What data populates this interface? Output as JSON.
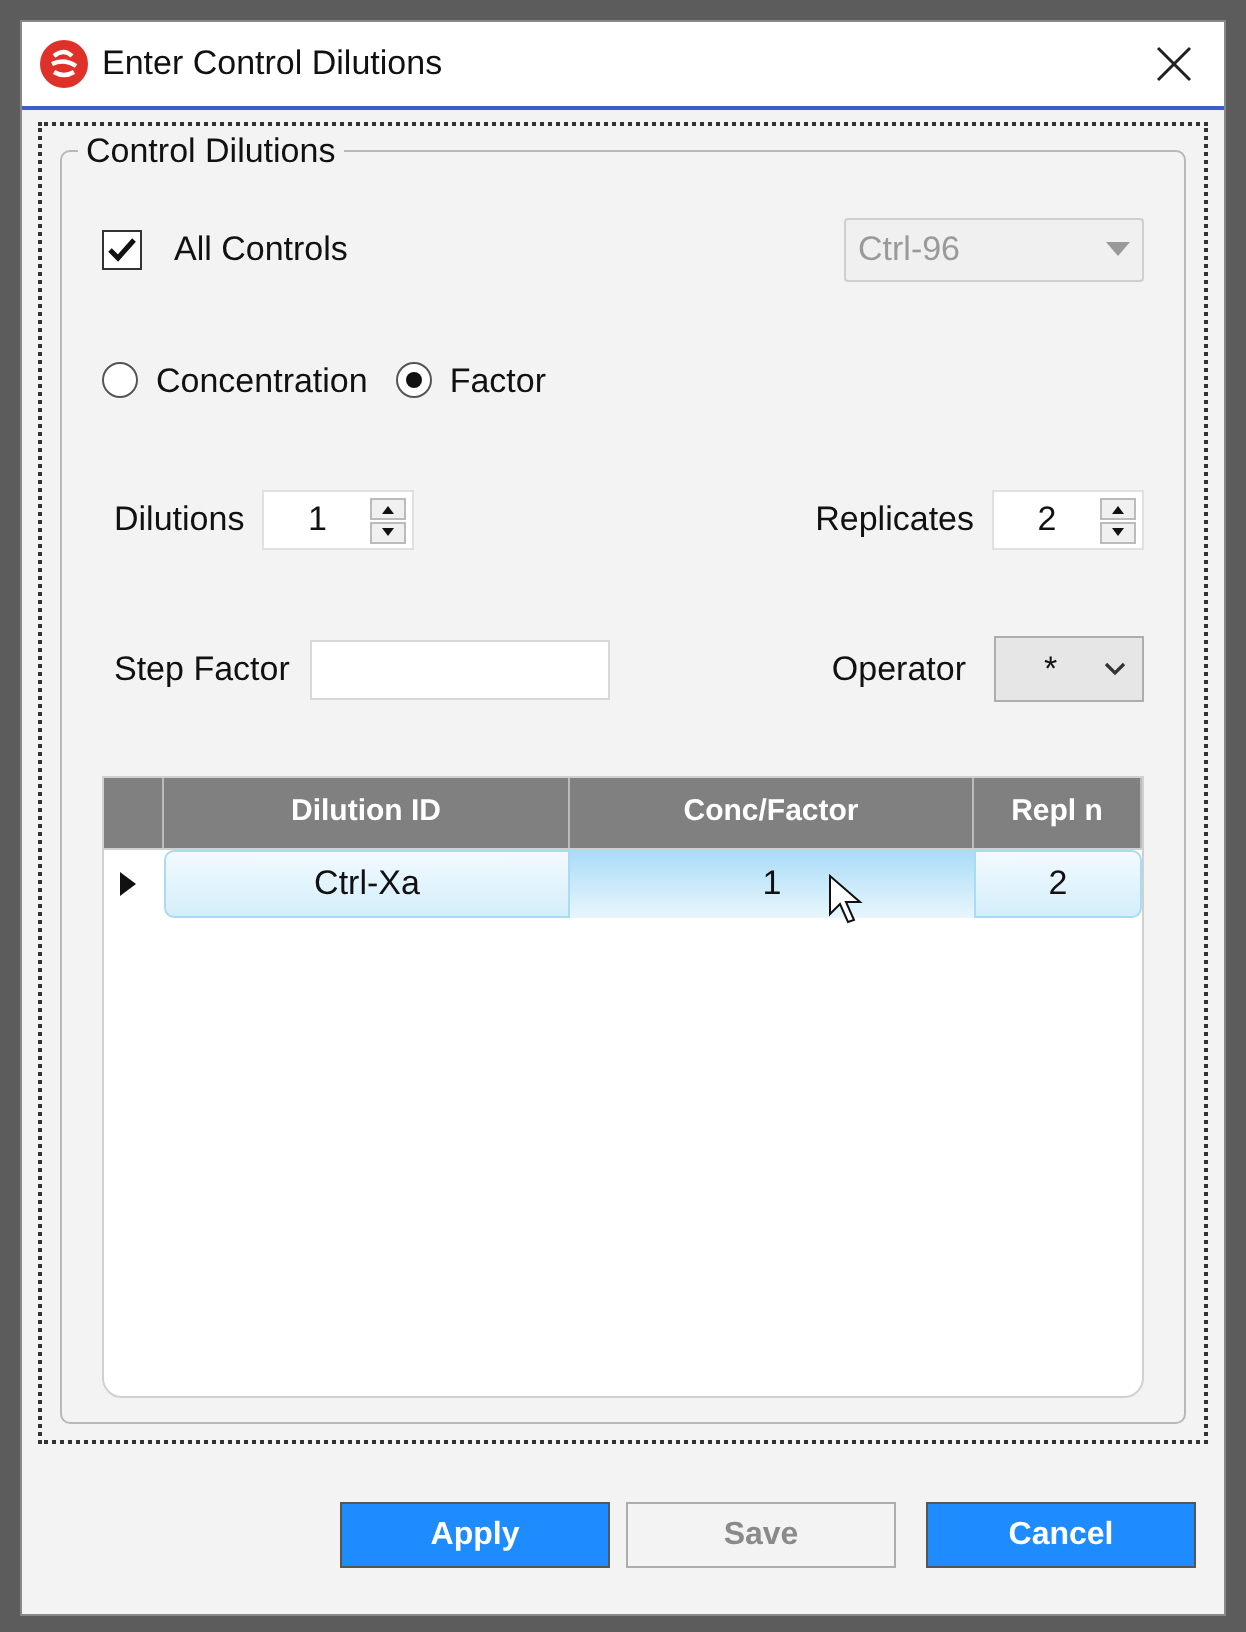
{
  "window": {
    "title": "Enter Control Dilutions"
  },
  "group": {
    "title": "Control Dilutions",
    "all_controls": {
      "label": "All Controls",
      "checked": true
    },
    "control_select": {
      "value": "Ctrl-96",
      "disabled": true
    },
    "mode": [
      {
        "label": "Concentration",
        "selected": false
      },
      {
        "label": "Factor",
        "selected": true
      }
    ],
    "dilutions": {
      "label": "Dilutions",
      "value": "1"
    },
    "replicates": {
      "label": "Replicates",
      "value": "2"
    },
    "step_factor": {
      "label": "Step Factor"
    },
    "operator": {
      "label": "Operator",
      "value": "*"
    },
    "table": {
      "columns": [
        "Dilution ID",
        "Conc/Factor",
        "Repl n"
      ],
      "rows": [
        {
          "cells": [
            "Ctrl-Xa",
            "1",
            "2"
          ],
          "selected": true,
          "current": true
        }
      ]
    }
  },
  "buttons": [
    {
      "label": "Apply",
      "disabled": false
    },
    {
      "label": "Save",
      "disabled": true
    },
    {
      "label": "Cancel",
      "disabled": false
    }
  ]
}
